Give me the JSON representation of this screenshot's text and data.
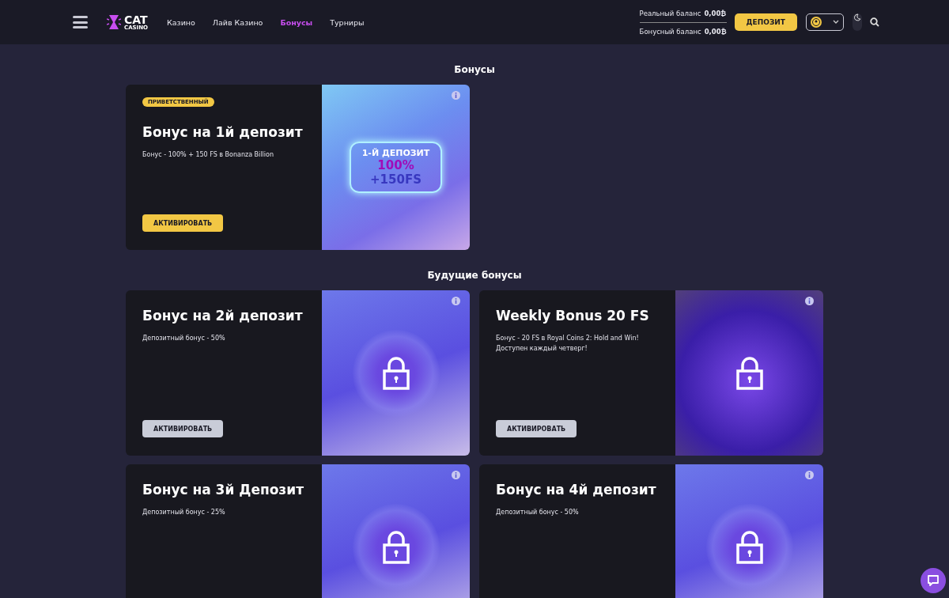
{
  "header": {
    "logo": {
      "line1": "CAT",
      "line2": "CASINO"
    },
    "nav": [
      {
        "label": "Казино",
        "selected": false
      },
      {
        "label": "Лайв Казино",
        "selected": false
      },
      {
        "label": "Бонусы",
        "selected": true
      },
      {
        "label": "Турниры",
        "selected": false
      }
    ],
    "balances": [
      {
        "label": "Реальный баланс",
        "value": "0,00₿"
      },
      {
        "label": "Бонусный баланс",
        "value": "0,00₿"
      }
    ],
    "deposit_button": "ДЕПОЗИТ"
  },
  "sections": [
    {
      "title": "Бонусы",
      "cards": [
        {
          "badge": "ПРИВЕТСТВЕННЫЙ",
          "title": "Бонус на 1й депозит",
          "description": "Бонус - 100% + 150 FS в Bonanza Billion",
          "button": {
            "label": "АКТИВИРОВАТЬ",
            "disabled": false
          },
          "image": {
            "kind": "promo",
            "line1": "1-Й ДЕПОЗИТ",
            "line2": "100%",
            "line3": "+150FS"
          }
        }
      ]
    },
    {
      "title": "Будущие бонусы",
      "cards": [
        {
          "title": "Бонус на 2й депозит",
          "description": "Депозитный бонус - 50%",
          "button": {
            "label": "АКТИВИРОВАТЬ",
            "disabled": true
          },
          "image": {
            "kind": "locked"
          }
        },
        {
          "title": "Weekly Bonus 20 FS",
          "description": "Бонус - 20 FS в Royal Coins 2: Hold and Win! Доступен каждый четверг!",
          "button": {
            "label": "АКТИВИРОВАТЬ",
            "disabled": true
          },
          "image": {
            "kind": "locked_photo"
          }
        },
        {
          "title": "Бонус на 3й Депозит",
          "description": "Депозитный бонус - 25%",
          "image": {
            "kind": "locked"
          }
        },
        {
          "title": "Бонус на 4й депозит",
          "description": "Депозитный бонус - 50%",
          "image": {
            "kind": "locked"
          }
        }
      ]
    }
  ]
}
